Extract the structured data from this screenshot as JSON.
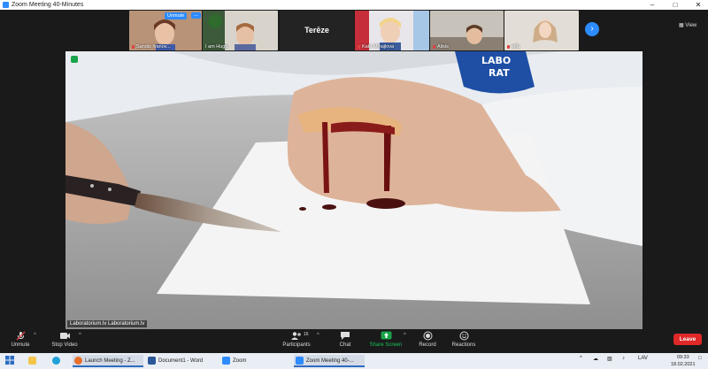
{
  "window": {
    "title": "Zoom Meeting 40-Minutes"
  },
  "gallery": {
    "tiles": [
      {
        "name": "Sandis Ivanov...",
        "muted": true,
        "unmute_label": "Unmute",
        "more_label": "..."
      },
      {
        "name": "I am Hugo",
        "muted": false
      },
      {
        "name": "Terēze",
        "name_only": true
      },
      {
        "name": "Kate Mihajlova",
        "muted": true
      },
      {
        "name": "Alisis",
        "muted": true
      },
      {
        "name": "elfa",
        "muted": true
      }
    ],
    "next_icon": "chevron-right-icon",
    "view_label": "View"
  },
  "video": {
    "speaker_name": "Laboratorium.lv Laboratorium.lv",
    "security_icon": "shield-icon"
  },
  "toolbar": {
    "unmute": "Unmute",
    "stop_video": "Stop Video",
    "participants": "Participants",
    "participants_count": "16",
    "chat": "Chat",
    "share_screen": "Share Screen",
    "record": "Record",
    "reactions": "Reactions",
    "leave": "Leave",
    "share_color": "#19a34a",
    "leave_color": "#e02828"
  },
  "taskbar": {
    "items": [
      {
        "label": "Launch Meeting - Z..."
      },
      {
        "label": "Document1 - Word"
      },
      {
        "label": "Zoom"
      },
      {
        "label": "Zoom Meeting 40-..."
      }
    ],
    "language": "LAV",
    "time": "09:33",
    "date": "18.02.2021"
  }
}
